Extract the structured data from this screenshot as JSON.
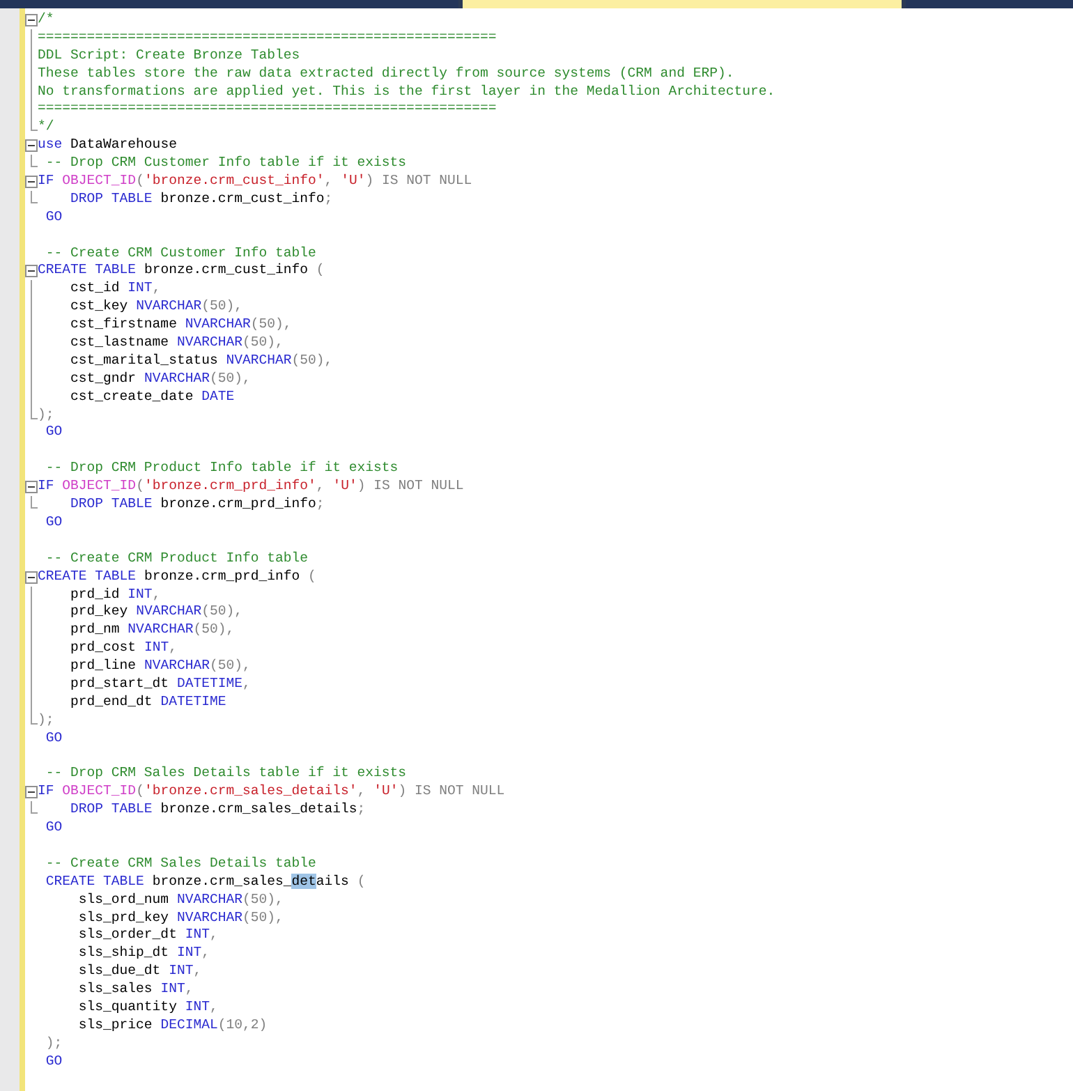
{
  "tabs": [
    {
      "selected": false
    },
    {
      "selected": true
    },
    {
      "selected": false
    }
  ],
  "editor": {
    "lines": [
      {
        "kind": "fold-start",
        "tokens": [
          {
            "kind": "comment",
            "text": "/*"
          }
        ]
      },
      {
        "kind": "fold-inner",
        "tokens": [
          {
            "kind": "comment",
            "text": "========================================================"
          }
        ]
      },
      {
        "kind": "fold-inner",
        "tokens": [
          {
            "kind": "comment",
            "text": "DDL Script: Create Bronze Tables"
          }
        ]
      },
      {
        "kind": "fold-inner",
        "tokens": [
          {
            "kind": "comment",
            "text": "These tables store the raw data extracted directly from source systems (CRM and ERP)."
          }
        ]
      },
      {
        "kind": "fold-inner",
        "tokens": [
          {
            "kind": "comment",
            "text": "No transformations are applied yet. This is the first layer in the Medallion Architecture."
          }
        ]
      },
      {
        "kind": "fold-inner",
        "tokens": [
          {
            "kind": "comment",
            "text": "========================================================"
          }
        ]
      },
      {
        "kind": "fold-end",
        "tokens": [
          {
            "kind": "comment",
            "text": "*/"
          }
        ]
      },
      {
        "kind": "fold-start",
        "tokens": [
          {
            "kind": "keyword",
            "text": "use"
          },
          {
            "kind": "plain",
            "text": " DataWarehouse"
          }
        ]
      },
      {
        "kind": "fold-end",
        "tokens": [
          {
            "kind": "comment",
            "text": " -- Drop CRM Customer Info table if it exists"
          }
        ]
      },
      {
        "kind": "fold-start",
        "tokens": [
          {
            "kind": "keyword",
            "text": "IF "
          },
          {
            "kind": "function",
            "text": "OBJECT_ID"
          },
          {
            "kind": "operator",
            "text": "("
          },
          {
            "kind": "string",
            "text": "'bronze.crm_cust_info'"
          },
          {
            "kind": "operator",
            "text": ", "
          },
          {
            "kind": "string",
            "text": "'U'"
          },
          {
            "kind": "operator",
            "text": ") IS NOT NULL"
          }
        ]
      },
      {
        "kind": "fold-end",
        "tokens": [
          {
            "kind": "keyword",
            "text": "    DROP TABLE"
          },
          {
            "kind": "plain",
            "text": " bronze.crm_cust_info"
          },
          {
            "kind": "operator",
            "text": ";"
          }
        ]
      },
      {
        "kind": "plain",
        "tokens": [
          {
            "kind": "keyword",
            "text": " GO"
          }
        ]
      },
      {
        "kind": "plain"
      },
      {
        "kind": "plain",
        "tokens": [
          {
            "kind": "comment",
            "text": " -- Create CRM Customer Info table"
          }
        ]
      },
      {
        "kind": "fold-start",
        "tokens": [
          {
            "kind": "keyword",
            "text": "CREATE TABLE"
          },
          {
            "kind": "plain",
            "text": " bronze.crm_cust_info "
          },
          {
            "kind": "operator",
            "text": "("
          }
        ]
      },
      {
        "kind": "fold-inner",
        "tokens": [
          {
            "kind": "plain",
            "text": "    cst_id "
          },
          {
            "kind": "keyword",
            "text": "INT"
          },
          {
            "kind": "operator",
            "text": ","
          }
        ]
      },
      {
        "kind": "fold-inner",
        "tokens": [
          {
            "kind": "plain",
            "text": "    cst_key "
          },
          {
            "kind": "keyword",
            "text": "NVARCHAR"
          },
          {
            "kind": "operator",
            "text": "(50),"
          }
        ]
      },
      {
        "kind": "fold-inner",
        "tokens": [
          {
            "kind": "plain",
            "text": "    cst_firstname "
          },
          {
            "kind": "keyword",
            "text": "NVARCHAR"
          },
          {
            "kind": "operator",
            "text": "(50),"
          }
        ]
      },
      {
        "kind": "fold-inner",
        "tokens": [
          {
            "kind": "plain",
            "text": "    cst_lastname "
          },
          {
            "kind": "keyword",
            "text": "NVARCHAR"
          },
          {
            "kind": "operator",
            "text": "(50),"
          }
        ]
      },
      {
        "kind": "fold-inner",
        "tokens": [
          {
            "kind": "plain",
            "text": "    cst_marital_status "
          },
          {
            "kind": "keyword",
            "text": "NVARCHAR"
          },
          {
            "kind": "operator",
            "text": "(50),"
          }
        ]
      },
      {
        "kind": "fold-inner",
        "tokens": [
          {
            "kind": "plain",
            "text": "    cst_gndr "
          },
          {
            "kind": "keyword",
            "text": "NVARCHAR"
          },
          {
            "kind": "operator",
            "text": "(50),"
          }
        ]
      },
      {
        "kind": "fold-inner",
        "tokens": [
          {
            "kind": "plain",
            "text": "    cst_create_date "
          },
          {
            "kind": "keyword",
            "text": "DATE"
          }
        ]
      },
      {
        "kind": "fold-end",
        "tokens": [
          {
            "kind": "operator",
            "text": ");"
          }
        ]
      },
      {
        "kind": "plain",
        "tokens": [
          {
            "kind": "keyword",
            "text": " GO"
          }
        ]
      },
      {
        "kind": "plain"
      },
      {
        "kind": "plain",
        "tokens": [
          {
            "kind": "comment",
            "text": " -- Drop CRM Product Info table if it exists"
          }
        ]
      },
      {
        "kind": "fold-start",
        "tokens": [
          {
            "kind": "keyword",
            "text": "IF "
          },
          {
            "kind": "function",
            "text": "OBJECT_ID"
          },
          {
            "kind": "operator",
            "text": "("
          },
          {
            "kind": "string",
            "text": "'bronze.crm_prd_info'"
          },
          {
            "kind": "operator",
            "text": ", "
          },
          {
            "kind": "string",
            "text": "'U'"
          },
          {
            "kind": "operator",
            "text": ") IS NOT NULL"
          }
        ]
      },
      {
        "kind": "fold-end",
        "tokens": [
          {
            "kind": "keyword",
            "text": "    DROP TABLE"
          },
          {
            "kind": "plain",
            "text": " bronze.crm_prd_info"
          },
          {
            "kind": "operator",
            "text": ";"
          }
        ]
      },
      {
        "kind": "plain",
        "tokens": [
          {
            "kind": "keyword",
            "text": " GO"
          }
        ]
      },
      {
        "kind": "plain"
      },
      {
        "kind": "plain",
        "tokens": [
          {
            "kind": "comment",
            "text": " -- Create CRM Product Info table"
          }
        ]
      },
      {
        "kind": "fold-start",
        "tokens": [
          {
            "kind": "keyword",
            "text": "CREATE TABLE"
          },
          {
            "kind": "plain",
            "text": " bronze.crm_prd_info "
          },
          {
            "kind": "operator",
            "text": "("
          }
        ]
      },
      {
        "kind": "fold-inner",
        "tokens": [
          {
            "kind": "plain",
            "text": "    prd_id "
          },
          {
            "kind": "keyword",
            "text": "INT"
          },
          {
            "kind": "operator",
            "text": ","
          }
        ]
      },
      {
        "kind": "fold-inner",
        "tokens": [
          {
            "kind": "plain",
            "text": "    prd_key "
          },
          {
            "kind": "keyword",
            "text": "NVARCHAR"
          },
          {
            "kind": "operator",
            "text": "(50),"
          }
        ]
      },
      {
        "kind": "fold-inner",
        "tokens": [
          {
            "kind": "plain",
            "text": "    prd_nm "
          },
          {
            "kind": "keyword",
            "text": "NVARCHAR"
          },
          {
            "kind": "operator",
            "text": "(50),"
          }
        ]
      },
      {
        "kind": "fold-inner",
        "tokens": [
          {
            "kind": "plain",
            "text": "    prd_cost "
          },
          {
            "kind": "keyword",
            "text": "INT"
          },
          {
            "kind": "operator",
            "text": ","
          }
        ]
      },
      {
        "kind": "fold-inner",
        "tokens": [
          {
            "kind": "plain",
            "text": "    prd_line "
          },
          {
            "kind": "keyword",
            "text": "NVARCHAR"
          },
          {
            "kind": "operator",
            "text": "(50),"
          }
        ]
      },
      {
        "kind": "fold-inner",
        "tokens": [
          {
            "kind": "plain",
            "text": "    prd_start_dt "
          },
          {
            "kind": "keyword",
            "text": "DATETIME"
          },
          {
            "kind": "operator",
            "text": ","
          }
        ]
      },
      {
        "kind": "fold-inner",
        "tokens": [
          {
            "kind": "plain",
            "text": "    prd_end_dt "
          },
          {
            "kind": "keyword",
            "text": "DATETIME"
          }
        ]
      },
      {
        "kind": "fold-end",
        "tokens": [
          {
            "kind": "operator",
            "text": ");"
          }
        ]
      },
      {
        "kind": "plain",
        "tokens": [
          {
            "kind": "keyword",
            "text": " GO"
          }
        ]
      },
      {
        "kind": "plain"
      },
      {
        "kind": "plain",
        "tokens": [
          {
            "kind": "comment",
            "text": " -- Drop CRM Sales Details table if it exists"
          }
        ]
      },
      {
        "kind": "fold-start",
        "tokens": [
          {
            "kind": "keyword",
            "text": "IF "
          },
          {
            "kind": "function",
            "text": "OBJECT_ID"
          },
          {
            "kind": "operator",
            "text": "("
          },
          {
            "kind": "string",
            "text": "'bronze.crm_sales_details'"
          },
          {
            "kind": "operator",
            "text": ", "
          },
          {
            "kind": "string",
            "text": "'U'"
          },
          {
            "kind": "operator",
            "text": ") IS NOT NULL"
          }
        ]
      },
      {
        "kind": "fold-end",
        "tokens": [
          {
            "kind": "keyword",
            "text": "    DROP TABLE"
          },
          {
            "kind": "plain",
            "text": " bronze.crm_sales_details"
          },
          {
            "kind": "operator",
            "text": ";"
          }
        ]
      },
      {
        "kind": "plain",
        "tokens": [
          {
            "kind": "keyword",
            "text": " GO"
          }
        ]
      },
      {
        "kind": "plain"
      },
      {
        "kind": "plain",
        "tokens": [
          {
            "kind": "comment",
            "text": " -- Create CRM Sales Details table"
          }
        ]
      },
      {
        "kind": "plain",
        "tokens": [
          {
            "kind": "keyword",
            "text": " CREATE TABLE"
          },
          {
            "kind": "plain",
            "text": " bronze.crm_sales_"
          },
          {
            "kind": "selection",
            "text": "det"
          },
          {
            "kind": "plain",
            "text": "ails "
          },
          {
            "kind": "operator",
            "text": "("
          }
        ]
      },
      {
        "kind": "plain",
        "tokens": [
          {
            "kind": "plain",
            "text": "     sls_ord_num "
          },
          {
            "kind": "keyword",
            "text": "NVARCHAR"
          },
          {
            "kind": "operator",
            "text": "(50),"
          }
        ]
      },
      {
        "kind": "plain",
        "tokens": [
          {
            "kind": "plain",
            "text": "     sls_prd_key "
          },
          {
            "kind": "keyword",
            "text": "NVARCHAR"
          },
          {
            "kind": "operator",
            "text": "(50),"
          }
        ]
      },
      {
        "kind": "plain",
        "tokens": [
          {
            "kind": "plain",
            "text": "     sls_order_dt "
          },
          {
            "kind": "keyword",
            "text": "INT"
          },
          {
            "kind": "operator",
            "text": ","
          }
        ]
      },
      {
        "kind": "plain",
        "tokens": [
          {
            "kind": "plain",
            "text": "     sls_ship_dt "
          },
          {
            "kind": "keyword",
            "text": "INT"
          },
          {
            "kind": "operator",
            "text": ","
          }
        ]
      },
      {
        "kind": "plain",
        "tokens": [
          {
            "kind": "plain",
            "text": "     sls_due_dt "
          },
          {
            "kind": "keyword",
            "text": "INT"
          },
          {
            "kind": "operator",
            "text": ","
          }
        ]
      },
      {
        "kind": "plain",
        "tokens": [
          {
            "kind": "plain",
            "text": "     sls_sales "
          },
          {
            "kind": "keyword",
            "text": "INT"
          },
          {
            "kind": "operator",
            "text": ","
          }
        ]
      },
      {
        "kind": "plain",
        "tokens": [
          {
            "kind": "plain",
            "text": "     sls_quantity "
          },
          {
            "kind": "keyword",
            "text": "INT"
          },
          {
            "kind": "operator",
            "text": ","
          }
        ]
      },
      {
        "kind": "plain",
        "tokens": [
          {
            "kind": "plain",
            "text": "     sls_price "
          },
          {
            "kind": "keyword",
            "text": "DECIMAL"
          },
          {
            "kind": "operator",
            "text": "(10,2)"
          }
        ]
      },
      {
        "kind": "plain",
        "tokens": [
          {
            "kind": "operator",
            "text": " );"
          }
        ]
      },
      {
        "kind": "plain",
        "tokens": [
          {
            "kind": "keyword",
            "text": " GO"
          }
        ]
      }
    ]
  }
}
